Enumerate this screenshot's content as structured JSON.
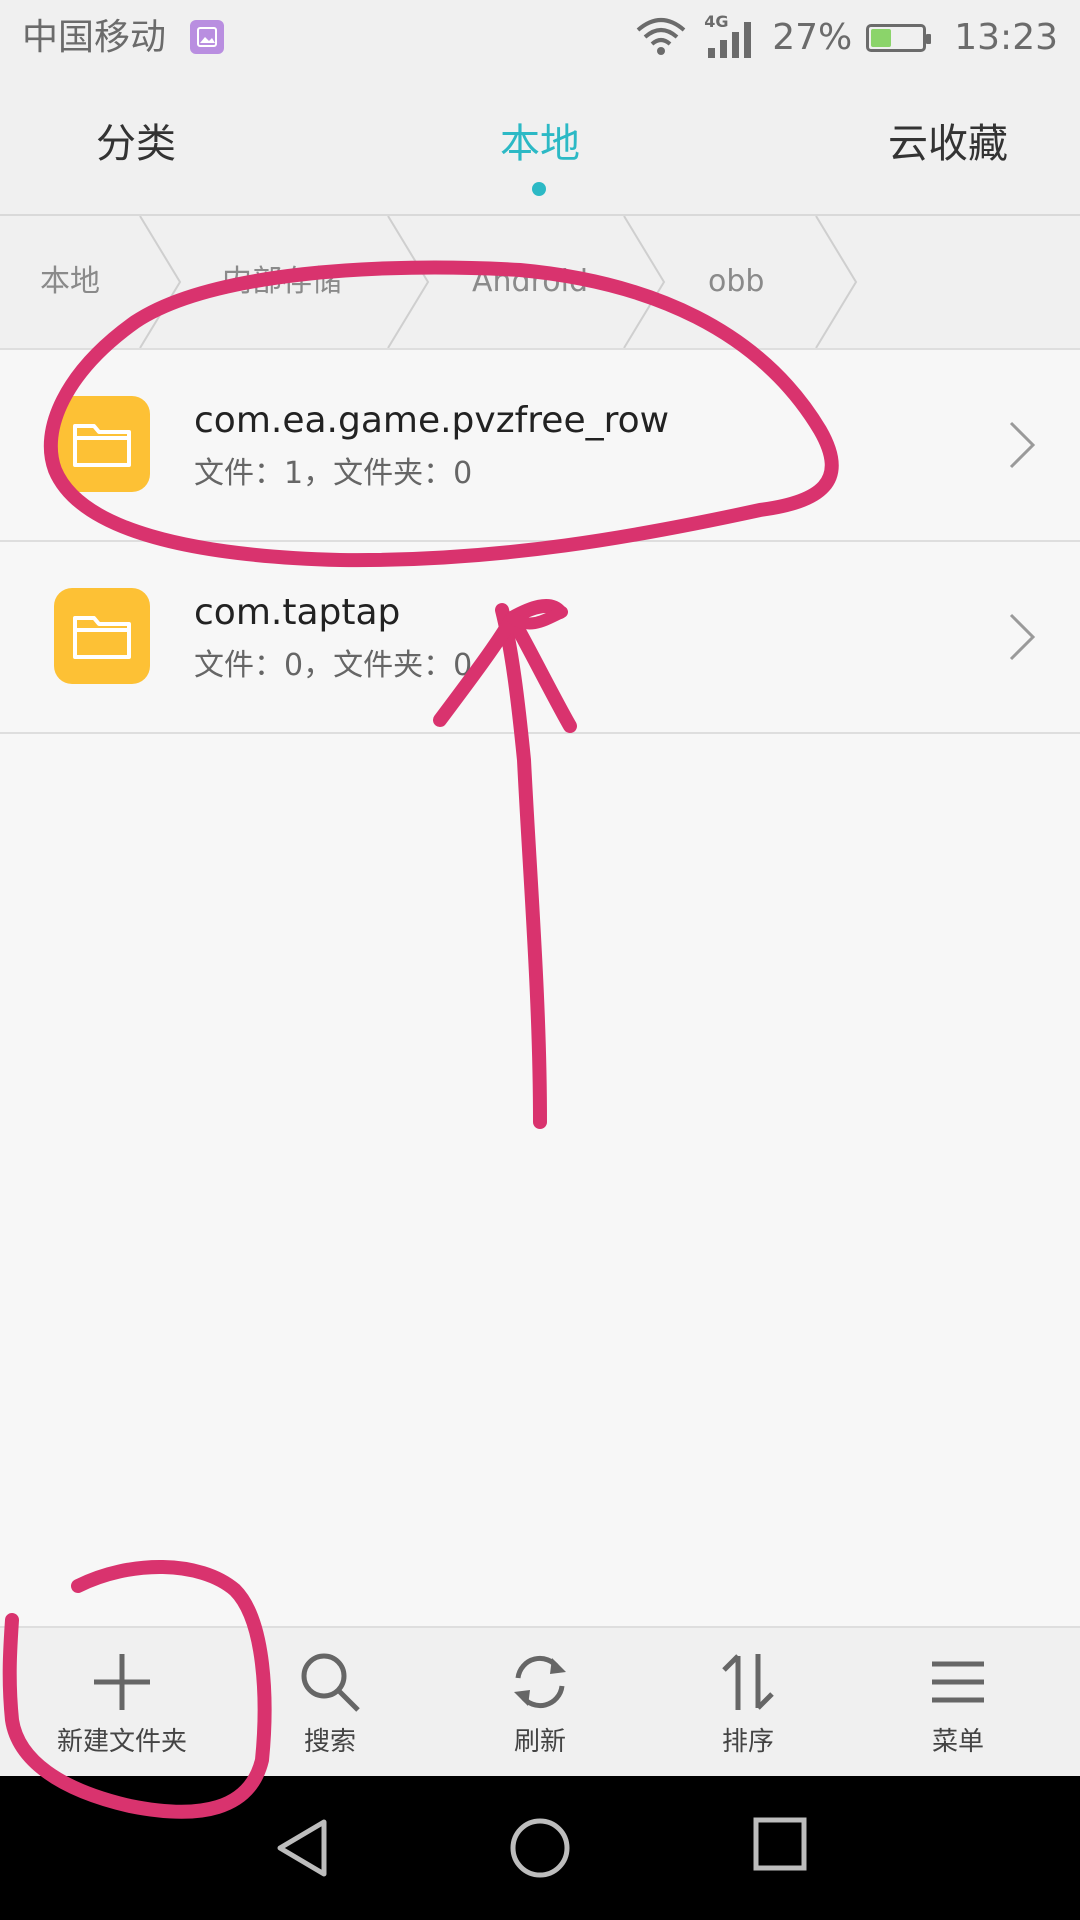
{
  "status_bar": {
    "carrier": "中国移动",
    "network": "4G",
    "battery_percent": "27%",
    "time": "13:23"
  },
  "tabs": [
    {
      "label": "分类",
      "active": false
    },
    {
      "label": "本地",
      "active": true
    },
    {
      "label": "云收藏",
      "active": false
    }
  ],
  "breadcrumb": {
    "items": [
      "本地",
      "内部存储",
      "Android",
      "obb"
    ]
  },
  "files": [
    {
      "name": "com.ea.game.pvzfree_row",
      "meta": "文件：1，文件夹：0"
    },
    {
      "name": "com.taptap",
      "meta": "文件：0，文件夹：0"
    }
  ],
  "toolbar": {
    "new_folder": "新建文件夹",
    "search": "搜索",
    "refresh": "刷新",
    "sort": "排序",
    "menu": "菜单"
  },
  "colors": {
    "accent": "#2cb9c5",
    "folder": "#fdc135",
    "annotation": "#d9336e"
  }
}
